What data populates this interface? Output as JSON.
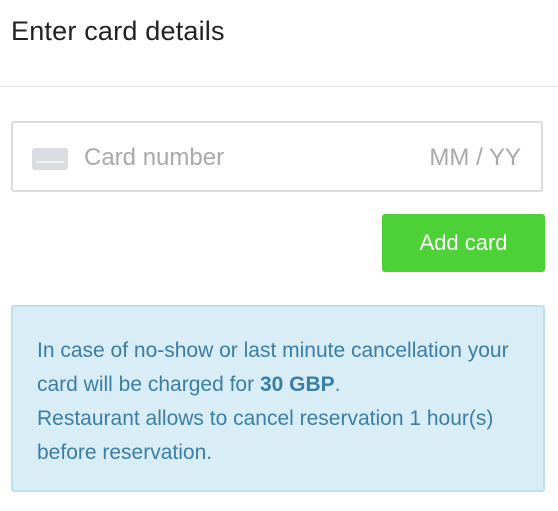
{
  "header": {
    "title": "Enter card details"
  },
  "card_form": {
    "card_icon": "credit-card-icon",
    "card_number_placeholder": "Card number",
    "card_number_value": "",
    "expiry_placeholder": "MM / YY",
    "expiry_value": "",
    "add_card_label": "Add card"
  },
  "notice": {
    "line1_prefix": "In case of no-show or last minute cancellation your card will be charged for ",
    "charge_amount": "30 GBP",
    "line1_suffix": ".",
    "line2": "Restaurant allows to cancel reservation 1 hour(s) before reservation."
  },
  "colors": {
    "accent_button": "#4cd137",
    "notice_background": "#d9edf7",
    "notice_text": "#3a7ea8"
  }
}
